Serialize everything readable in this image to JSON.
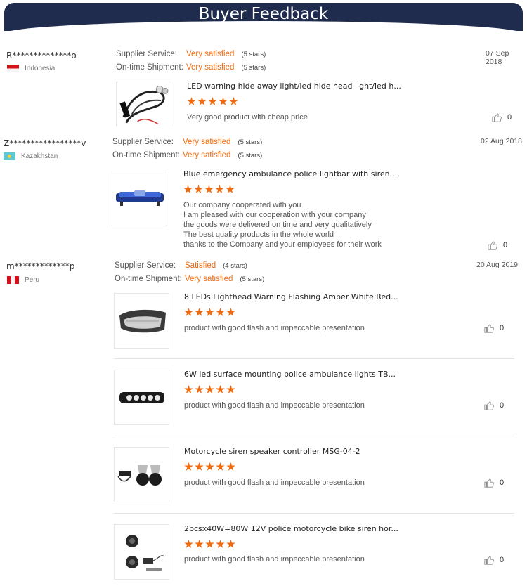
{
  "header": {
    "title": "Buyer Feedback"
  },
  "labels": {
    "supplier_service": "Supplier Service:",
    "on_time_shipment": "On-time Shipment:"
  },
  "reviews": [
    {
      "buyer": "R**************o",
      "country": "Indonesia",
      "date": "07 Sep 2018",
      "supplier_service": "Very satisfied",
      "supplier_service_stars": "(5 stars)",
      "on_time_shipment": "Very satisfied",
      "on_time_shipment_stars": "(5 stars)",
      "products": [
        {
          "title": "LED warning hide away light/led hide head light/led h...",
          "rating": 5,
          "comment": [
            "Very good product with cheap price"
          ],
          "likes": "0"
        }
      ]
    },
    {
      "buyer": "Z*****************v",
      "country": "Kazakhstan",
      "date": "02 Aug 2018",
      "supplier_service": "Very satisfied",
      "supplier_service_stars": "(5 stars)",
      "on_time_shipment": "Very satisfied",
      "on_time_shipment_stars": "(5 stars)",
      "products": [
        {
          "title": "Blue emergency ambulance police lightbar with siren ...",
          "rating": 5,
          "comment": [
            "Our company cooperated with you",
            "I am pleased with our cooperation with your company",
            "the goods were delivered on time and very qualitatively",
            "The best quality products in the whole world",
            "thanks to the Company and your employees for their work"
          ],
          "likes": "0"
        }
      ]
    },
    {
      "buyer": "m*************p",
      "country": "Peru",
      "date": "20 Aug 2019",
      "supplier_service": "Satisfied",
      "supplier_service_stars": "(4 stars)",
      "on_time_shipment": "Very satisfied",
      "on_time_shipment_stars": "(5 stars)",
      "products": [
        {
          "title": "8 LEDs Lighthead Warning Flashing Amber White Red...",
          "rating": 5,
          "comment": [
            "product with good flash and impeccable presentation"
          ],
          "likes": "0"
        },
        {
          "title": "6W led surface mounting police ambulance lights TB...",
          "rating": 5,
          "comment": [
            "product with good flash and impeccable presentation"
          ],
          "likes": "0"
        },
        {
          "title": "Motorcycle siren speaker controller MSG-04-2",
          "rating": 5,
          "comment": [
            "product with good flash and impeccable presentation"
          ],
          "likes": "0"
        },
        {
          "title": "2pcsx40W=80W 12V police motorcycle bike siren hor...",
          "rating": 5,
          "comment": [
            "product with good flash and impeccable presentation"
          ],
          "likes": "0"
        }
      ]
    }
  ]
}
